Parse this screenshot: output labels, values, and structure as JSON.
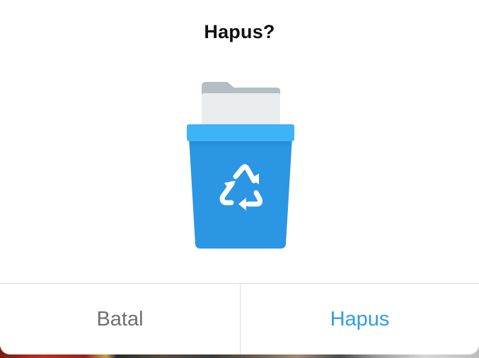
{
  "dialog": {
    "title": "Hapus?",
    "illustration_icon": "recycle-bin-icon",
    "cancel_label": "Batal",
    "confirm_label": "Hapus"
  },
  "colors": {
    "accent": "#2F9BE8",
    "bin_body": "#2B96E4",
    "bin_lid": "#3EB3F7",
    "cancel_text": "#6F6F6F",
    "title_text": "#111111"
  }
}
